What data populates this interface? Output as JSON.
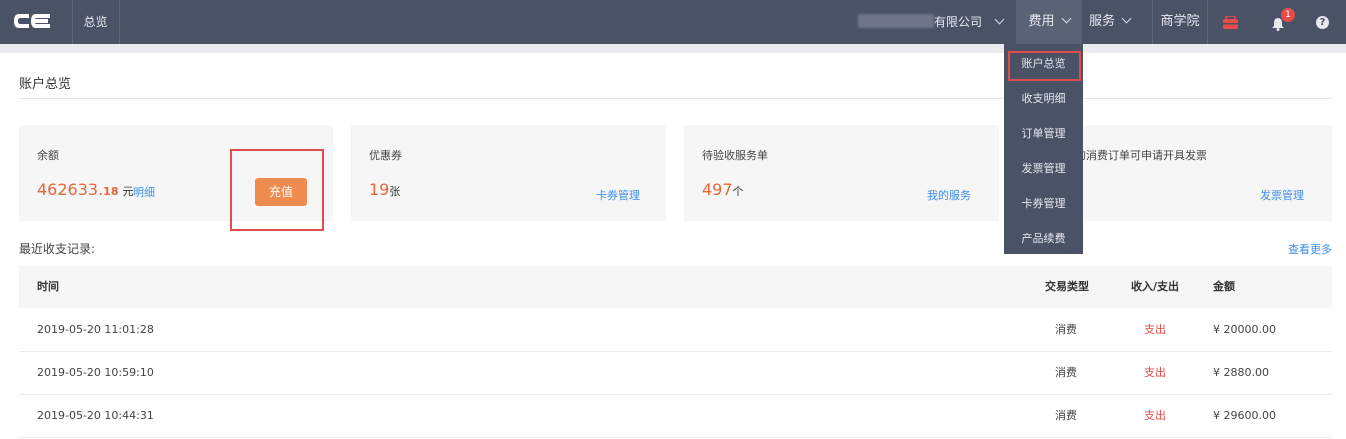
{
  "topbar": {
    "overview": "总览",
    "company_suffix": "有限公司",
    "fees": "费用",
    "service": "服务",
    "school": "商学院",
    "notification_count": "1",
    "help": "?"
  },
  "fees_menu": {
    "items": [
      "账户总览",
      "收支明细",
      "订单管理",
      "发票管理",
      "卡券管理",
      "产品续费"
    ]
  },
  "page": {
    "title": "账户总览"
  },
  "cards": {
    "balance": {
      "label": "余额",
      "value_int": "462633.",
      "value_dec": "18",
      "unit": "元",
      "link": "明细",
      "button": "充值"
    },
    "coupon": {
      "label": "优惠券",
      "value": "19",
      "unit": "张",
      "link": "卡券管理"
    },
    "pending": {
      "label": "待验收服务单",
      "value": "497",
      "unit": "个",
      "link": "我的服务"
    },
    "invoice": {
      "label": "的消费订单可申请开具发票",
      "link": "发票管理"
    }
  },
  "records": {
    "title": "最近收支记录:",
    "more": "查看更多",
    "headers": {
      "time": "时间",
      "type": "交易类型",
      "io": "收入/支出",
      "amount": "金额"
    },
    "rows": [
      {
        "time": "2019-05-20 11:01:28",
        "type": "消费",
        "io": "支出",
        "amount": "¥ 20000.00"
      },
      {
        "time": "2019-05-20 10:59:10",
        "type": "消费",
        "io": "支出",
        "amount": "¥ 2880.00"
      },
      {
        "time": "2019-05-20 10:44:31",
        "type": "消费",
        "io": "支出",
        "amount": "¥ 29600.00"
      }
    ]
  }
}
